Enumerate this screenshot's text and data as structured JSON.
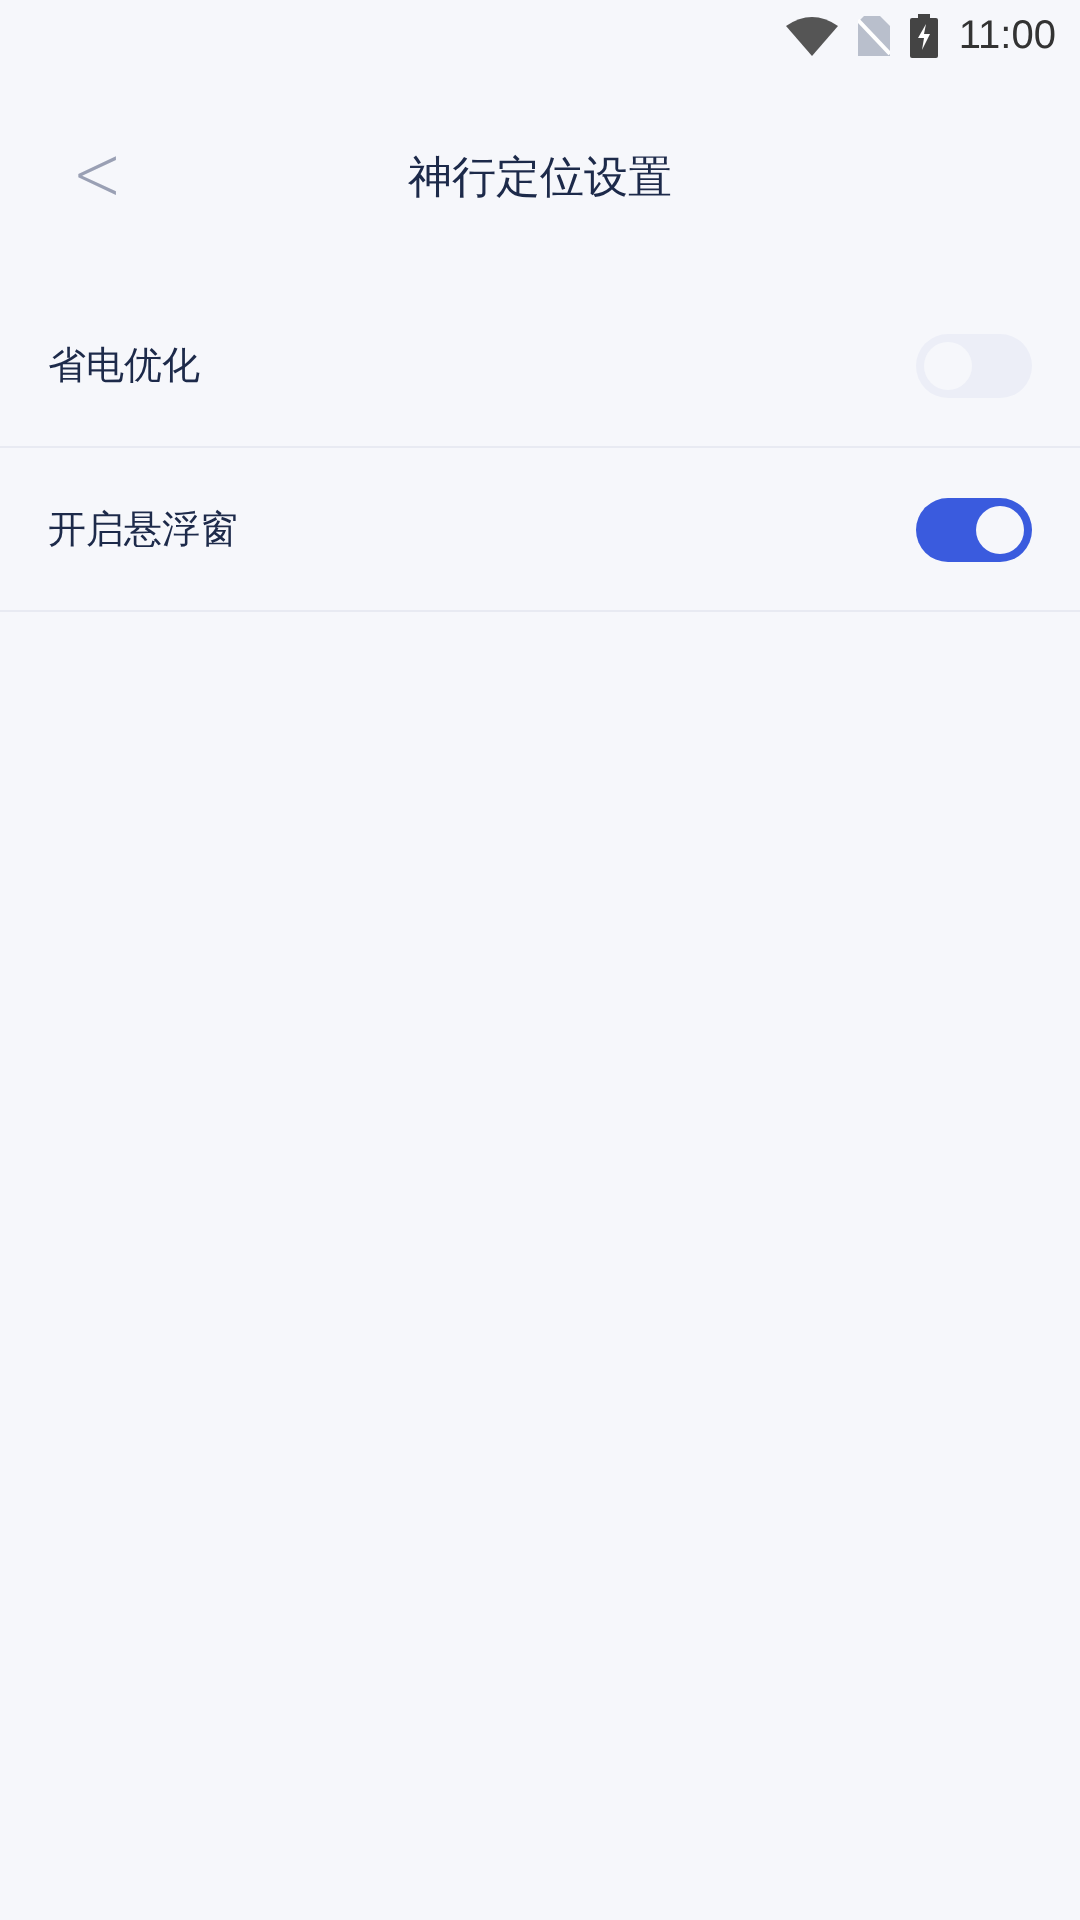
{
  "status_bar": {
    "time": "11:00"
  },
  "header": {
    "back": "<",
    "title": "神行定位设置"
  },
  "settings": [
    {
      "label": "省电优化",
      "on": false
    },
    {
      "label": "开启悬浮窗",
      "on": true
    }
  ]
}
